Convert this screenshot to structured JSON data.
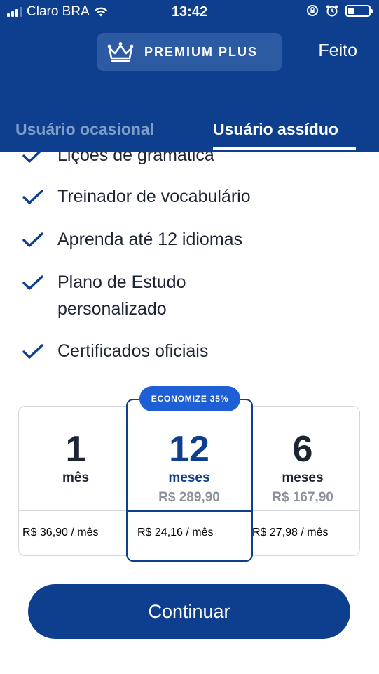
{
  "status_bar": {
    "carrier": "Claro BRA",
    "time": "13:42"
  },
  "header": {
    "premium_label": "PREMIUM PLUS",
    "done_label": "Feito",
    "colors": {
      "background": "#0d3f8e",
      "pill": "#2c5aa3"
    }
  },
  "tabs": [
    {
      "label": "Usuário ocasional",
      "active": false
    },
    {
      "label": "Usuário assíduo",
      "active": true
    }
  ],
  "features": [
    {
      "label": "Lições de gramática"
    },
    {
      "label": "Treinador de vocabulário"
    },
    {
      "label": "Aprenda até 12 idiomas"
    },
    {
      "label": "Plano de Estudo",
      "label2": "personalizado"
    },
    {
      "label": "Certificados oficiais"
    }
  ],
  "plans": {
    "badge": "ECONOMIZE 35%",
    "items": [
      {
        "number": "1",
        "unit": "mês",
        "total": "",
        "monthly": "R$ 36,90 / mês",
        "selected": false
      },
      {
        "number": "12",
        "unit": "meses",
        "total": "R$ 289,90",
        "monthly": "R$ 24,16 / mês",
        "selected": true
      },
      {
        "number": "6",
        "unit": "meses",
        "total": "R$ 167,90",
        "monthly": "R$ 27,98 / mês",
        "selected": false
      }
    ]
  },
  "cta": {
    "label": "Continuar",
    "color": "#0d3f8e"
  }
}
